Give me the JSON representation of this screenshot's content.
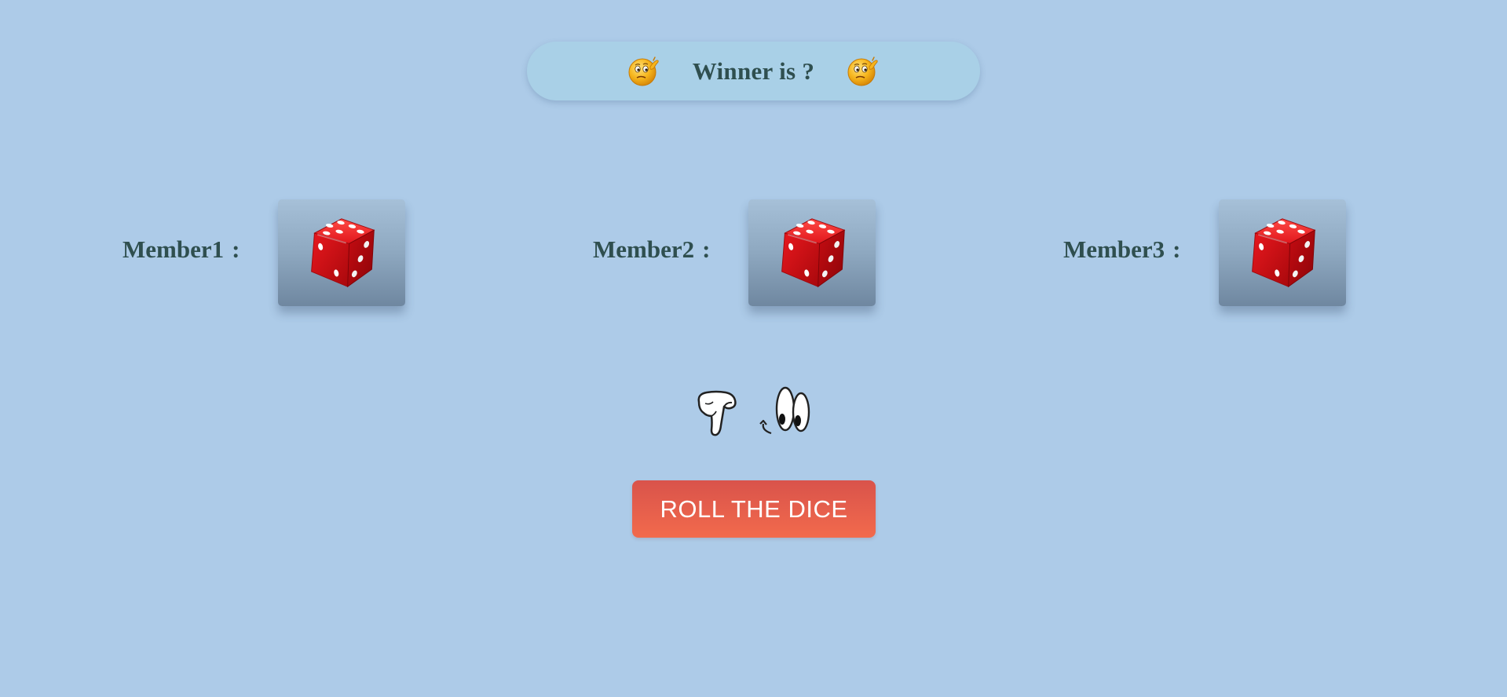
{
  "banner": {
    "text": "Winner is ?",
    "left_icon": "thinking-face-icon",
    "right_icon": "thinking-face-icon"
  },
  "members": [
    {
      "name": "Member1",
      "separator": ":",
      "die_face": 6,
      "die_icon": "red-dice-icon"
    },
    {
      "name": "Member2",
      "separator": ":",
      "die_face": 6,
      "die_icon": "red-dice-icon"
    },
    {
      "name": "Member3",
      "separator": ":",
      "die_face": 6,
      "die_icon": "red-dice-icon"
    }
  ],
  "hint": {
    "icons": [
      "pointing-hand-icon",
      "cartoon-eyes-icon"
    ]
  },
  "roll_button": {
    "label": "ROLL THE DICE"
  },
  "colors": {
    "background": "#adcbe8",
    "banner_background": "#a9d0e7",
    "text": "#2f4f4f",
    "button_top": "#d9534b",
    "button_bottom": "#f26a4c",
    "button_text": "#ffffff",
    "die_red": "#d8141a",
    "die_pips": "#ffffff"
  }
}
